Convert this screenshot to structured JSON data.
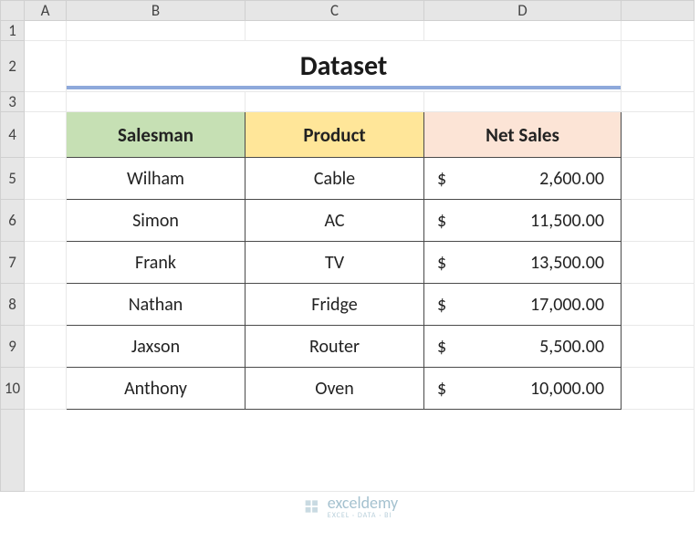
{
  "sheet": {
    "columns": [
      "A",
      "B",
      "C",
      "D"
    ],
    "rows": [
      "1",
      "2",
      "3",
      "4",
      "5",
      "6",
      "7",
      "8",
      "9",
      "10"
    ],
    "title": "Dataset",
    "headers": {
      "salesman": "Salesman",
      "product": "Product",
      "net_sales": "Net Sales"
    },
    "data": [
      {
        "salesman": "Wilham",
        "product": "Cable",
        "net_sales": "2,600.00"
      },
      {
        "salesman": "Simon",
        "product": "AC",
        "net_sales": "11,500.00"
      },
      {
        "salesman": "Frank",
        "product": "TV",
        "net_sales": "13,500.00"
      },
      {
        "salesman": "Nathan",
        "product": "Fridge",
        "net_sales": "17,000.00"
      },
      {
        "salesman": "Jaxson",
        "product": "Router",
        "net_sales": "5,500.00"
      },
      {
        "salesman": "Anthony",
        "product": "Oven",
        "net_sales": "10,000.00"
      }
    ],
    "currency_symbol": "$"
  },
  "watermark": {
    "name": "exceldemy",
    "sub": "EXCEL · DATA · BI"
  },
  "colors": {
    "title_underline": "#8ea9db",
    "hdr_b": "#c6e0b4",
    "hdr_c": "#ffe699",
    "hdr_d": "#fce4d6"
  }
}
